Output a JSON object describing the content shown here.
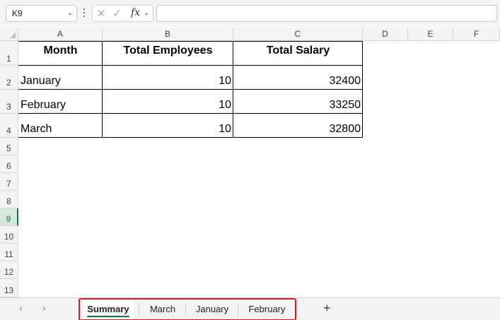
{
  "formula_bar": {
    "name_box": "K9",
    "fx_label": "fx",
    "formula": ""
  },
  "columns": [
    "A",
    "B",
    "C",
    "D",
    "E",
    "F"
  ],
  "rows": [
    "1",
    "2",
    "3",
    "4",
    "5",
    "6",
    "7",
    "8",
    "9",
    "10",
    "11",
    "12",
    "13"
  ],
  "selected_row": "9",
  "table": {
    "headers": [
      "Month",
      "Total Employees",
      "Total Salary"
    ],
    "rows": [
      [
        "January",
        "10",
        "32400"
      ],
      [
        "February",
        "10",
        "33250"
      ],
      [
        "March",
        "10",
        "32800"
      ]
    ]
  },
  "sheet_tabs": [
    "Summary",
    "March",
    "January",
    "February"
  ],
  "active_sheet": "Summary",
  "colors": {
    "accent": "#107c41",
    "highlight_border": "#d71d1d"
  }
}
